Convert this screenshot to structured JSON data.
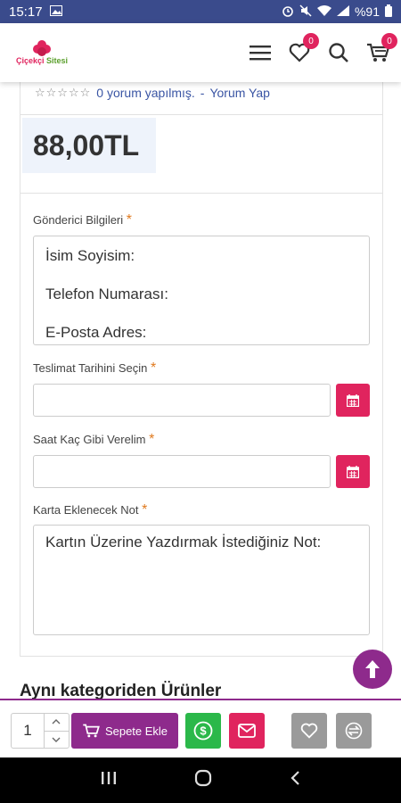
{
  "status_bar": {
    "time": "15:17",
    "battery": "%91"
  },
  "header": {
    "logo_part1": "Çiçekçi",
    "logo_part2": "Sitesi",
    "wishlist_count": "0",
    "cart_count": "0"
  },
  "rating": {
    "stars": "☆☆☆☆☆",
    "reviews_text": "0 yorum yapılmış.",
    "separator": "-",
    "write_review": "Yorum Yap"
  },
  "price": "88,00TL",
  "sender": {
    "label": "Gönderici Bilgileri",
    "lines": [
      "İsim Soyisim:",
      "Telefon Numarası:",
      "E-Posta Adres:"
    ]
  },
  "delivery_date": {
    "label": "Teslimat Tarihini Seçin",
    "value": ""
  },
  "delivery_time": {
    "label": "Saat Kaç Gibi Verelim",
    "value": ""
  },
  "card_note": {
    "label": "Karta Eklenecek Not",
    "placeholder": "Kartın Üzerine Yazdırmak İstediğiniz Not:"
  },
  "required_mark": "*",
  "related_title": "Aynı kategoriden Ürünler",
  "action_bar": {
    "quantity": "1",
    "add_to_cart": "Sepete Ekle"
  },
  "colors": {
    "brand_pink": "#e0245e",
    "brand_purple": "#8e2a8c",
    "green": "#2bb84a",
    "gray": "#9a9a9a"
  }
}
